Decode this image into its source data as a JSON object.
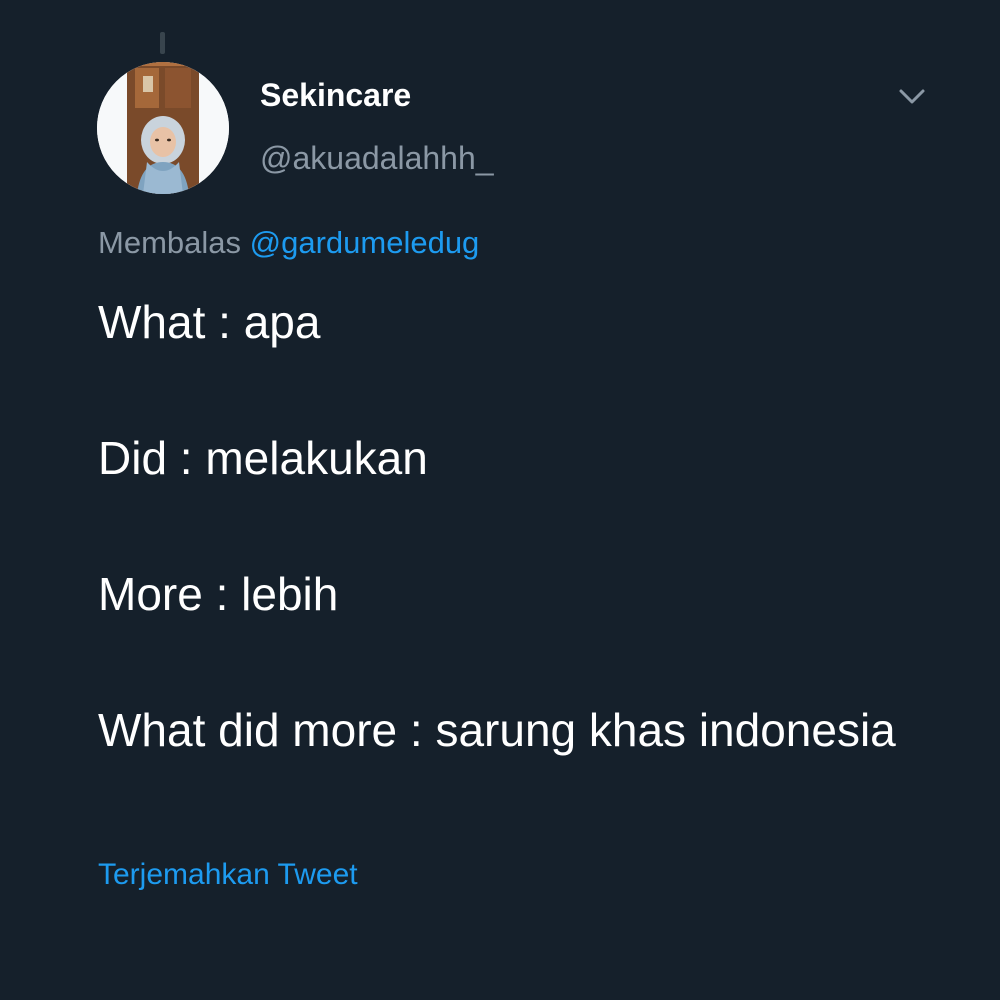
{
  "tweet": {
    "author": {
      "display_name": "Sekincare",
      "handle": "@akuadalahhh_",
      "avatar": "profile-photo"
    },
    "menu_icon": "chevron-down-icon",
    "reply_context": {
      "prefix": "Membalas",
      "mention": "@gardumeledug"
    },
    "lines": [
      "What : apa",
      "Did : melakukan",
      "More : lebih",
      "What did more : sarung khas indonesia"
    ],
    "translate_label": "Terjemahkan Tweet"
  },
  "colors": {
    "background": "#15202b",
    "primary_text": "#ffffff",
    "secondary_text": "#8b98a5",
    "link": "#1d9bf0"
  }
}
